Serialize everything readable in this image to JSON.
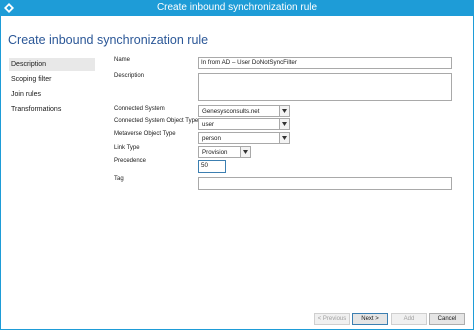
{
  "window": {
    "title": "Create inbound synchronization rule"
  },
  "page": {
    "title": "Create inbound synchronization rule"
  },
  "nav": {
    "items": [
      {
        "label": "Description",
        "active": true
      },
      {
        "label": "Scoping filter",
        "active": false
      },
      {
        "label": "Join rules",
        "active": false
      },
      {
        "label": "Transformations",
        "active": false
      }
    ]
  },
  "form": {
    "name": {
      "label": "Name",
      "value": "In from AD – User DoNotSyncFilter"
    },
    "description": {
      "label": "Description",
      "value": ""
    },
    "connected_system": {
      "label": "Connected System",
      "value": "Genesysconsults.net"
    },
    "connected_system_object_type": {
      "label": "Connected System Object Type",
      "value": "user"
    },
    "metaverse_object_type": {
      "label": "Metaverse Object Type",
      "value": "person"
    },
    "link_type": {
      "label": "Link Type",
      "value": "Provision"
    },
    "precedence": {
      "label": "Precedence",
      "value": "50"
    },
    "tag": {
      "label": "Tag",
      "value": ""
    }
  },
  "buttons": {
    "previous": "< Previous",
    "next": "Next >",
    "add": "Add",
    "cancel": "Cancel"
  },
  "colors": {
    "titlebar": "#1e9cd7",
    "page_title": "#2b5797",
    "active_nav": "#e8e8e8"
  }
}
